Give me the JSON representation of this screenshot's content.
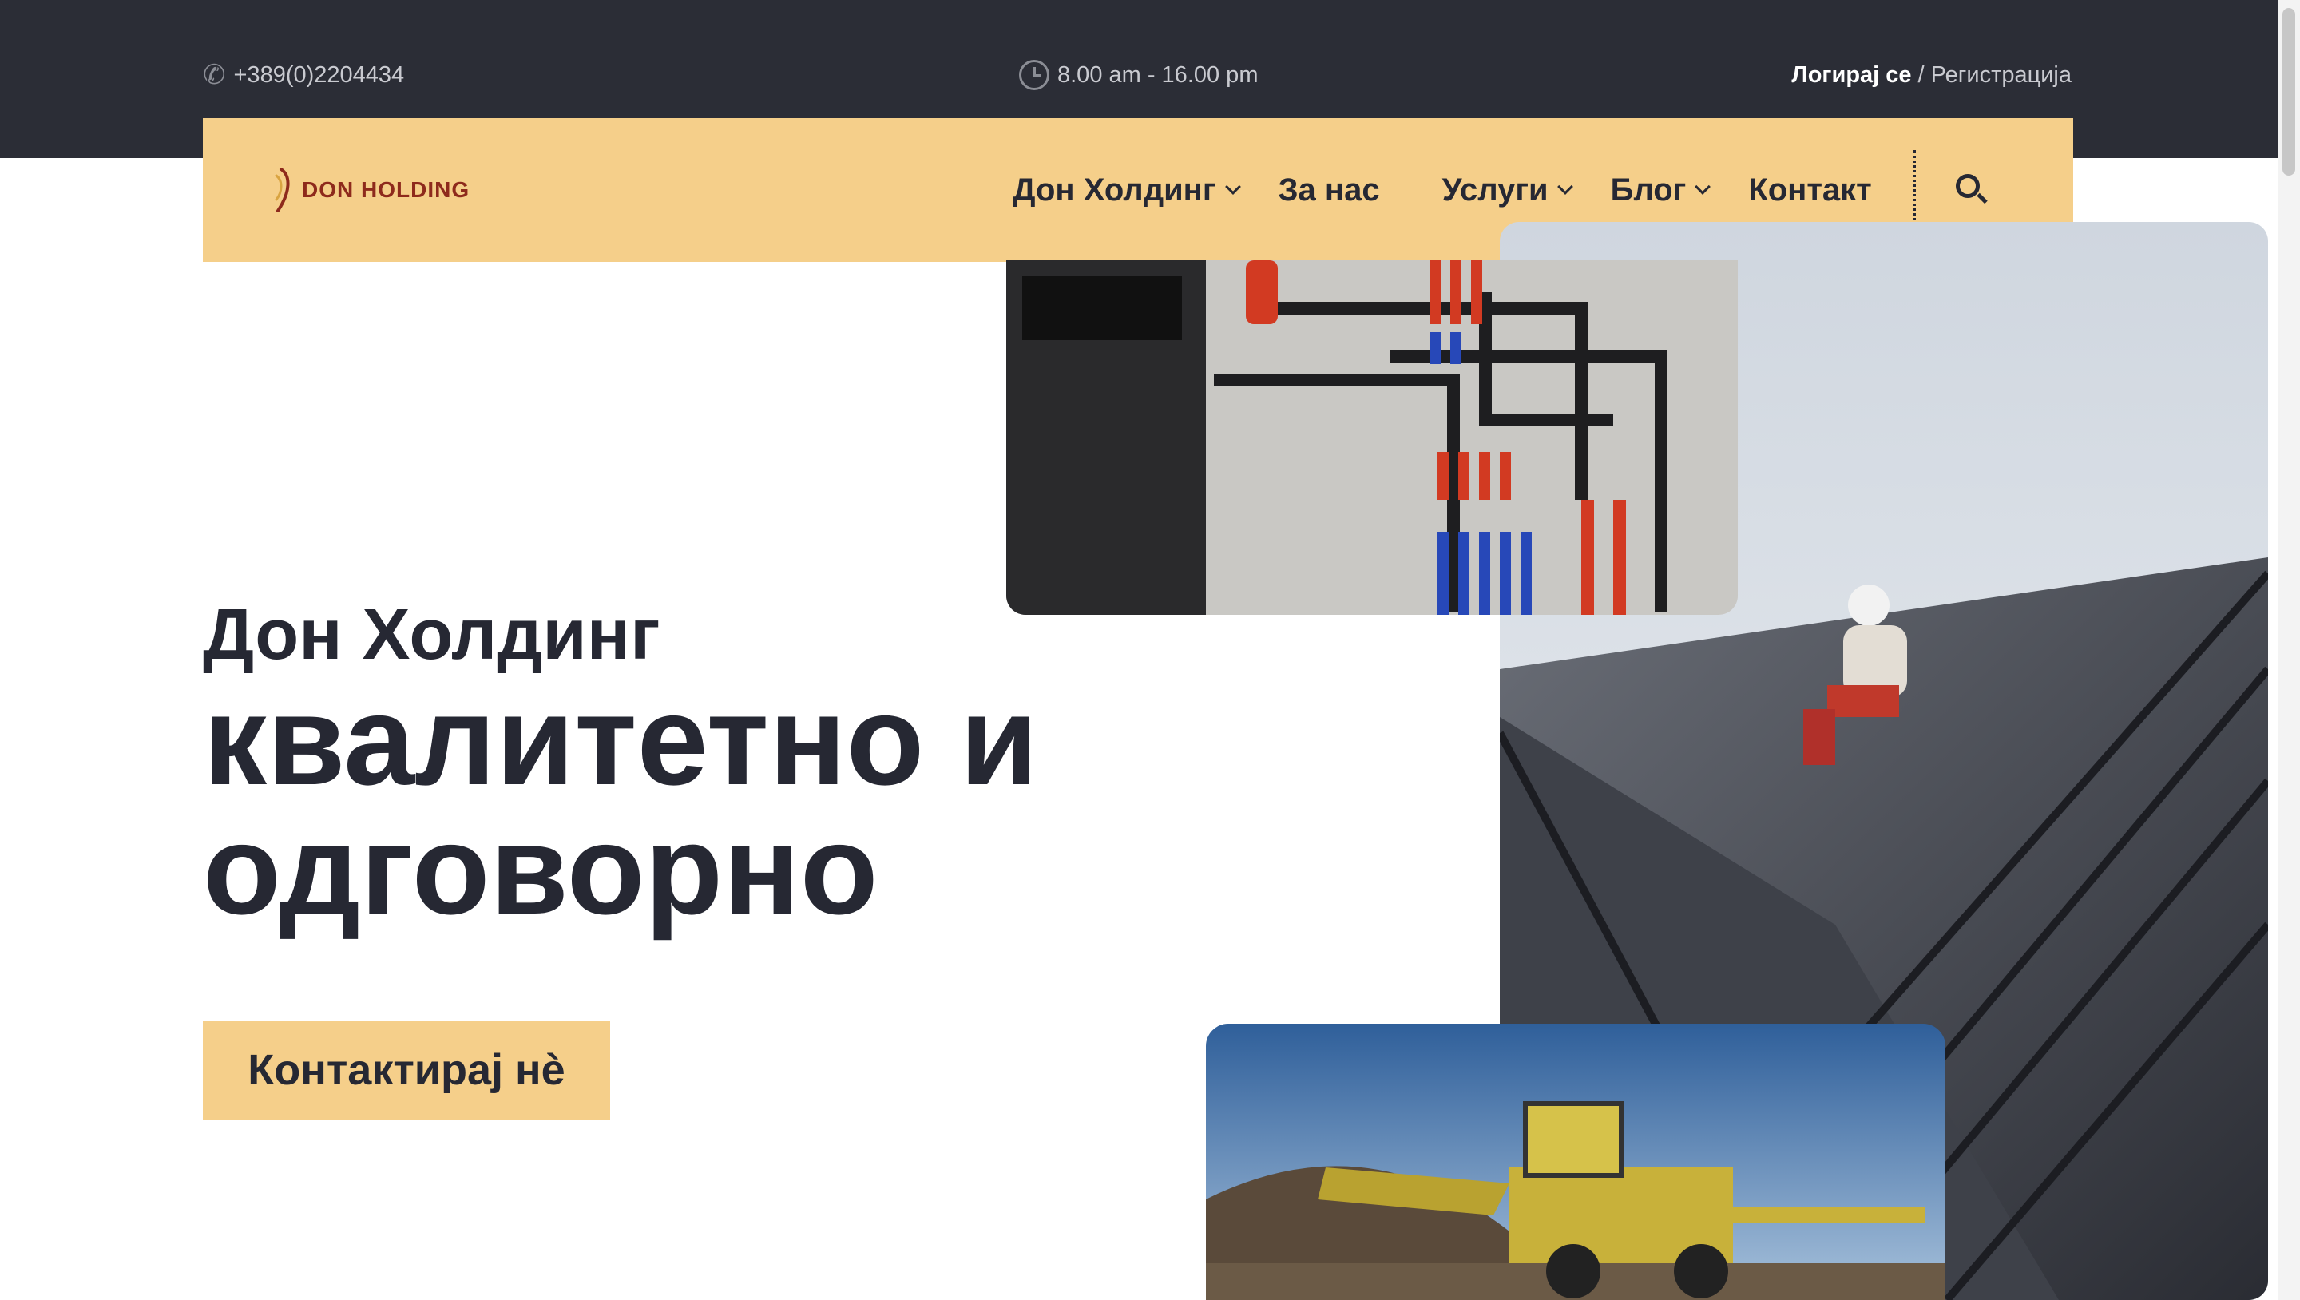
{
  "topbar": {
    "phone": "+389(0)2204434",
    "hours": "8.00 am - 16.00 pm",
    "login": "Логирај се",
    "separator": "/",
    "register": "Регистрација"
  },
  "brand": {
    "name": "DON HOLDING"
  },
  "nav": {
    "items": [
      {
        "label": "Дон Холдинг",
        "dropdown": true
      },
      {
        "label": "За нас",
        "dropdown": false
      },
      {
        "label": "Услуги",
        "dropdown": true
      },
      {
        "label": "Блог",
        "dropdown": true
      },
      {
        "label": "Контакт",
        "dropdown": false
      }
    ]
  },
  "hero": {
    "subtitle": "Дон Холдинг",
    "title_line1": "квалитетно и",
    "title_line2": "одговорно",
    "cta": "Контактирај нè"
  },
  "colors": {
    "accent": "#f5cf8a",
    "dark": "#2b2d36",
    "text": "#262833",
    "brand": "#8e2a1c"
  },
  "icons": [
    "phone-icon",
    "clock-icon",
    "chevron-down-icon",
    "search-icon"
  ]
}
